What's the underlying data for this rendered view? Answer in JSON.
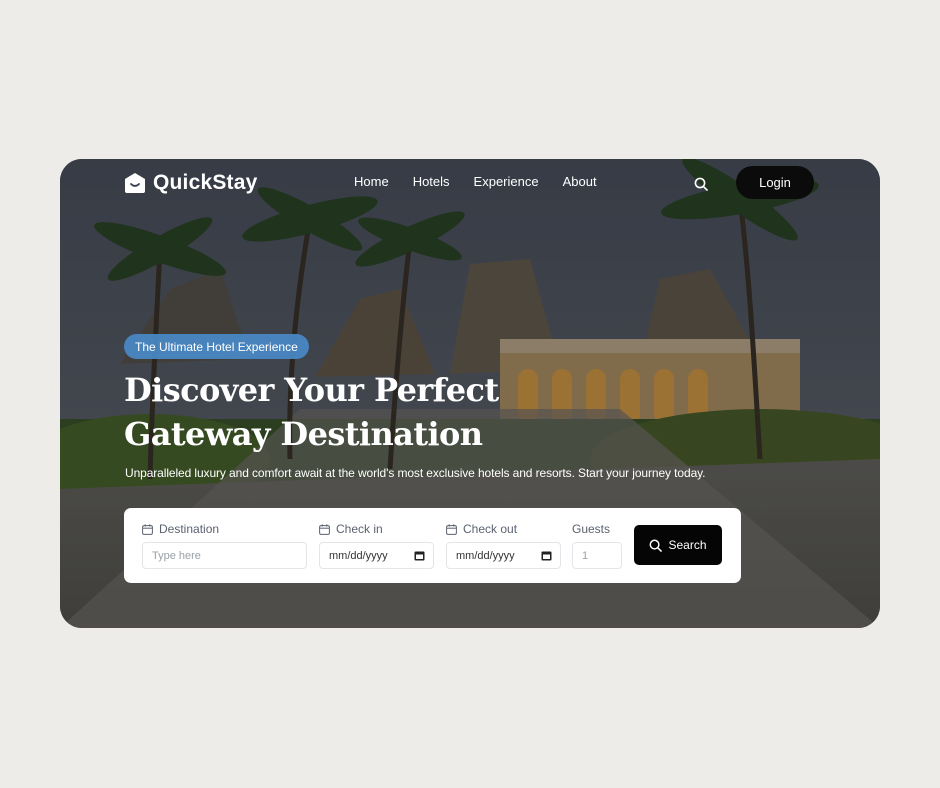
{
  "header": {
    "brand": "QuickStay",
    "nav": [
      {
        "label": "Home"
      },
      {
        "label": "Hotels"
      },
      {
        "label": "Experience"
      },
      {
        "label": "About"
      }
    ],
    "search_icon": "search-icon",
    "login_label": "Login"
  },
  "hero": {
    "badge": "The Ultimate Hotel Experience",
    "title_line1": "Discover Your Perfect",
    "title_line2": "Gateway Destination",
    "subtitle": "Unparalleled luxury and comfort await at the world's most exclusive hotels and resorts. Start your journey today."
  },
  "search_form": {
    "destination": {
      "label": "Destination",
      "placeholder": "Type here",
      "icon": "calendar-icon"
    },
    "check_in": {
      "label": "Check in",
      "value": "mm/dd/yyyy",
      "icon": "calendar-icon"
    },
    "check_out": {
      "label": "Check out",
      "value": "mm/dd/yyyy",
      "icon": "calendar-icon"
    },
    "guests": {
      "label": "Guests",
      "placeholder": "1"
    },
    "submit_label": "Search"
  },
  "colors": {
    "page_background": "#eeece9",
    "badge": "#4989c7",
    "button": "#050505",
    "text_on_hero": "#ffffff"
  }
}
